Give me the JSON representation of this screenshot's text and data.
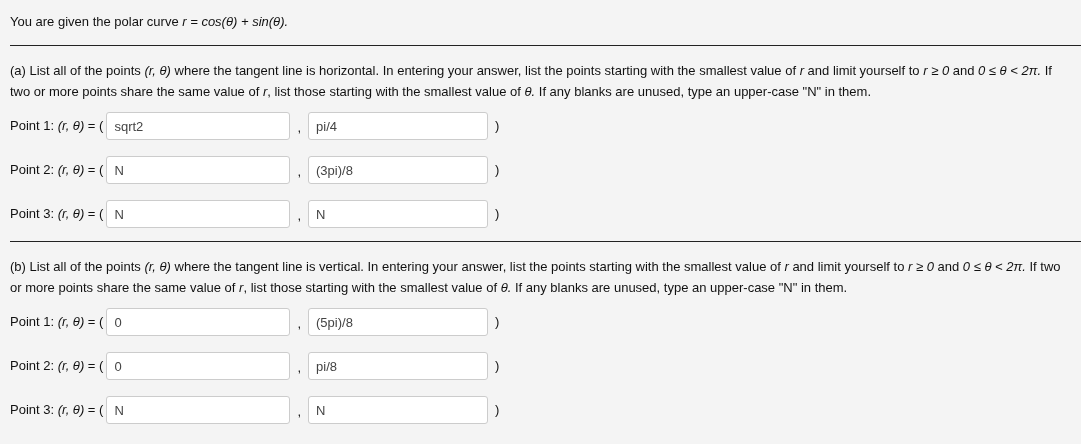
{
  "intro": "You are given the polar curve *r = cos(θ) + sin(θ).*",
  "parts": [
    {
      "question": "(a) List all of the points *(r, θ)* where the tangent line is horizontal. In entering your answer, list the points starting with the smallest value of *r* and limit yourself to *r ≥ 0* and *0 ≤ θ < 2π.* If two or more points share the same value of *r*, list those starting with the smallest value of *θ.* If any blanks are unused, type an upper-case \"N\" in them.",
      "points": [
        {
          "prefix": "Point 1: *(r, θ)* = (",
          "r": "sqrt2",
          "separator": ",",
          "theta": "pi/4",
          "suffix": ")"
        },
        {
          "prefix": "Point 2: *(r, θ)* = (",
          "r": "N",
          "separator": ",",
          "theta": "(3pi)/8",
          "suffix": ")"
        },
        {
          "prefix": "Point 3: *(r, θ)* = (",
          "r": "N",
          "separator": ",",
          "theta": "N",
          "suffix": ")"
        }
      ]
    },
    {
      "question": "(b) List all of the points *(r, θ)* where the tangent line is vertical. In entering your answer, list the points starting with the smallest value of *r* and limit yourself to *r ≥ 0* and *0 ≤ θ < 2π.* If two or more points share the same value of *r*, list those starting with the smallest value of *θ.* If any blanks are unused, type an upper-case \"N\" in them.",
      "points": [
        {
          "prefix": "Point 1: *(r, θ)* = (",
          "r": "0",
          "separator": ",",
          "theta": "(5pi)/8",
          "suffix": ")"
        },
        {
          "prefix": "Point 2: *(r, θ)* = (",
          "r": "0",
          "separator": ",",
          "theta": "pi/8",
          "suffix": ")"
        },
        {
          "prefix": "Point 3: *(r, θ)* = (",
          "r": "N",
          "separator": ",",
          "theta": "N",
          "suffix": ")"
        }
      ]
    }
  ]
}
